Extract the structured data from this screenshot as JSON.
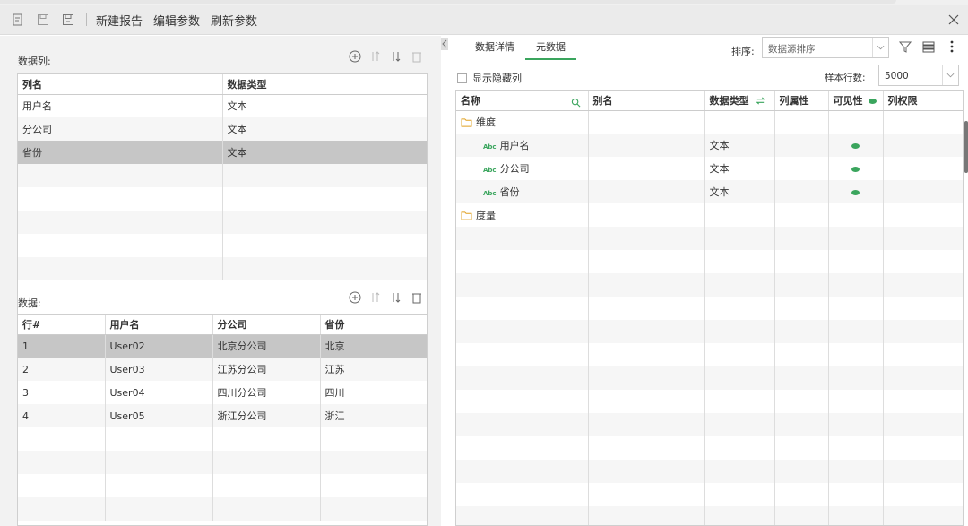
{
  "toolbar": {
    "new_report": "新建报告",
    "edit_params": "编辑参数",
    "refresh_params": "刷新参数"
  },
  "columns_section": {
    "title": "数据列:",
    "headers": [
      "列名",
      "数据类型"
    ],
    "rows": [
      [
        "用户名",
        "文本"
      ],
      [
        "分公司",
        "文本"
      ],
      [
        "省份",
        "文本"
      ]
    ],
    "selected_index": 2
  },
  "data_section": {
    "title": "数据:",
    "headers": [
      "行#",
      "用户名",
      "分公司",
      "省份"
    ],
    "rows": [
      [
        "1",
        "User02",
        "北京分公司",
        "北京"
      ],
      [
        "2",
        "User03",
        "江苏分公司",
        "江苏"
      ],
      [
        "3",
        "User04",
        "四川分公司",
        "四川"
      ],
      [
        "4",
        "User05",
        "浙江分公司",
        "浙江"
      ]
    ],
    "selected_index": 0
  },
  "right": {
    "tabs": [
      {
        "label": "数据详情",
        "active": false
      },
      {
        "label": "元数据",
        "active": true
      }
    ],
    "sort_label": "排序:",
    "sort_value": "数据源排序",
    "show_hidden_label": "显示隐藏列",
    "sample_label": "样本行数:",
    "sample_value": "5000",
    "meta_headers": [
      "名称",
      "别名",
      "数据类型",
      "列属性",
      "可见性",
      "列权限"
    ],
    "groups": [
      {
        "name": "维度",
        "items": [
          {
            "name": "用户名",
            "type": "文本",
            "visible": true
          },
          {
            "name": "分公司",
            "type": "文本",
            "visible": true
          },
          {
            "name": "省份",
            "type": "文本",
            "visible": true
          }
        ]
      },
      {
        "name": "度量",
        "items": []
      }
    ],
    "abc_tag": "Abc"
  },
  "colors": {
    "accent": "#3aa55d",
    "selected_row": "#c6c6c6",
    "toolbar_bg": "#ebebeb"
  }
}
